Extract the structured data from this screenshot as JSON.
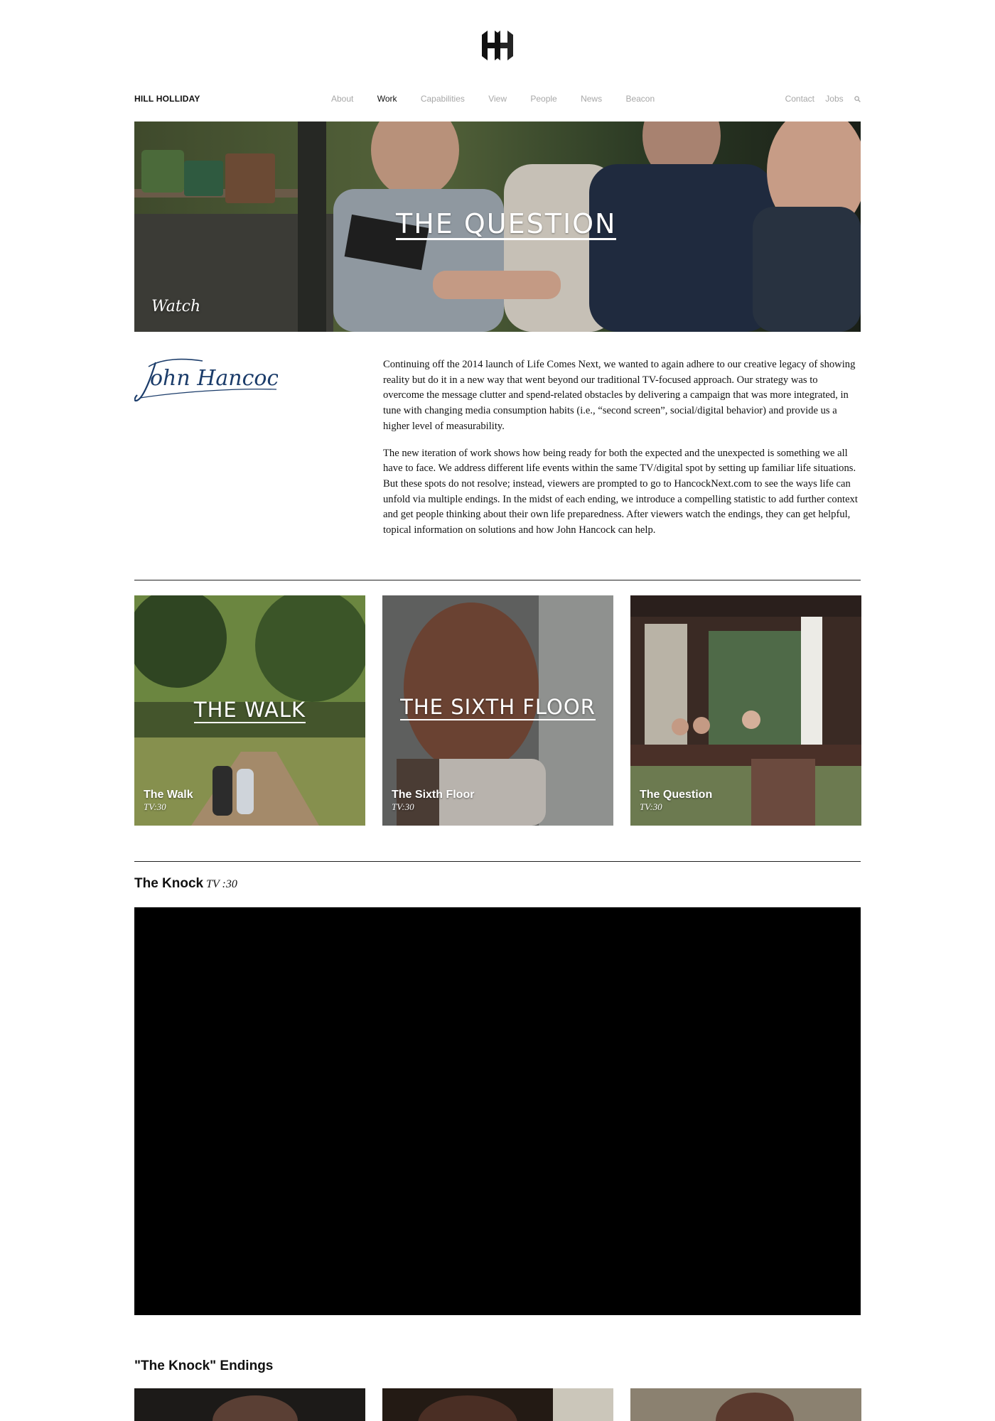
{
  "brand": {
    "name": "HILL HOLLIDAY",
    "logo_icon": "hh-monogram-icon"
  },
  "nav": {
    "items": [
      {
        "label": "About"
      },
      {
        "label": "Work",
        "active": true
      },
      {
        "label": "Capabilities"
      },
      {
        "label": "View"
      },
      {
        "label": "People"
      },
      {
        "label": "News"
      },
      {
        "label": "Beacon"
      }
    ],
    "right": [
      {
        "label": "Contact"
      },
      {
        "label": "Jobs"
      }
    ],
    "search_icon": "search-icon"
  },
  "hero": {
    "title": "THE QUESTION",
    "watch_label": "Watch"
  },
  "client": {
    "logo_text": "John Hancock"
  },
  "intro": {
    "paragraphs": [
      "Continuing off the 2014 launch of Life Comes Next, we wanted to again adhere to our creative legacy of showing reality but do it in a new way that went beyond our traditional TV-focused approach. Our strategy was to overcome the message clutter and spend-related obstacles by delivering a campaign that was more integrated, in tune with changing media consumption habits (i.e., “second screen”, social/digital behavior) and provide us a higher level of measurability.",
      "The new iteration of work shows how being ready for both the expected and the unexpected is something we all have to face. We address different life events within the same TV/digital spot by setting up familiar life situations. But these spots do not resolve; instead, viewers are prompted to go to HancockNext.com to see the ways life can unfold via multiple endings. In the midst of each ending, we introduce a compelling statistic to add further context and get people thinking about their own life preparedness. After viewers watch the endings, they can get helpful, topical information on solutions and how John Hancock can help."
    ]
  },
  "spots": [
    {
      "overlay": "THE WALK",
      "title": "The Walk",
      "subtitle": "TV:30"
    },
    {
      "overlay": "THE SIXTH FLOOR",
      "title": "The Sixth Floor",
      "subtitle": "TV:30"
    },
    {
      "overlay": "",
      "title": "The Question",
      "subtitle": "TV:30"
    }
  ],
  "feature": {
    "title": "The Knock",
    "subtitle": "TV :30"
  },
  "endings": {
    "title": "\"The Knock\" Endings"
  }
}
